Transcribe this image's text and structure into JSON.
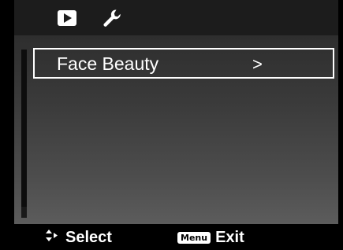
{
  "tabs": [
    {
      "icon": "play-icon",
      "active": false
    },
    {
      "icon": "wrench-icon",
      "active": true
    }
  ],
  "menu": {
    "items": [
      {
        "label": "Face Beauty",
        "arrow": ">",
        "selected": true
      }
    ]
  },
  "footer": {
    "select_label": "Select",
    "select_icon": "up-down-arrows-icon",
    "menu_key_label": "Menu",
    "exit_label": "Exit"
  },
  "colors": {
    "background": "#000000",
    "highlight_border": "#ffffff",
    "text": "#ffffff"
  }
}
